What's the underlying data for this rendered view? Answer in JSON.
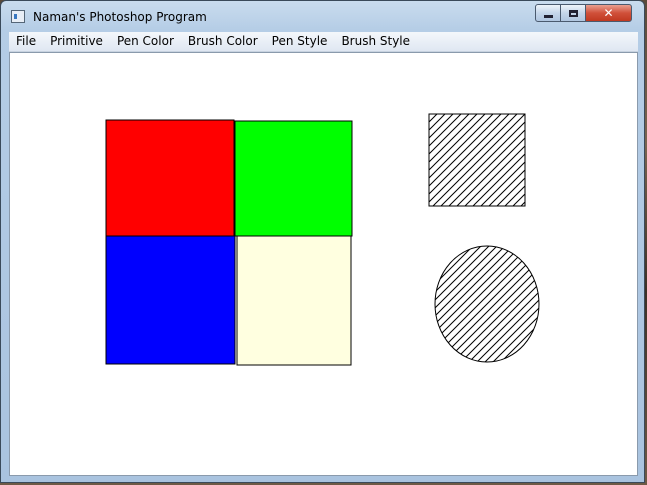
{
  "window": {
    "title": "Naman's Photoshop Program"
  },
  "menu": [
    "File",
    "Primitive",
    "Pen Color",
    "Brush Color",
    "Pen Style",
    "Brush Style"
  ],
  "canvas": {
    "background": "#ffffff",
    "shapes": [
      {
        "name": "red-square",
        "fill": "#ff0000"
      },
      {
        "name": "green-square",
        "fill": "#00ff00"
      },
      {
        "name": "blue-square",
        "fill": "#0000ff"
      },
      {
        "name": "cream-square",
        "fill": "#ffffe0"
      },
      {
        "name": "hatched-square",
        "fill": "diagonal-hatch"
      },
      {
        "name": "hatched-circle",
        "fill": "diagonal-hatch"
      }
    ]
  },
  "colors": {
    "red": "#ff0000",
    "green": "#00ff00",
    "blue": "#0000ff",
    "cream": "#ffffe0",
    "close": "#c8452e"
  }
}
